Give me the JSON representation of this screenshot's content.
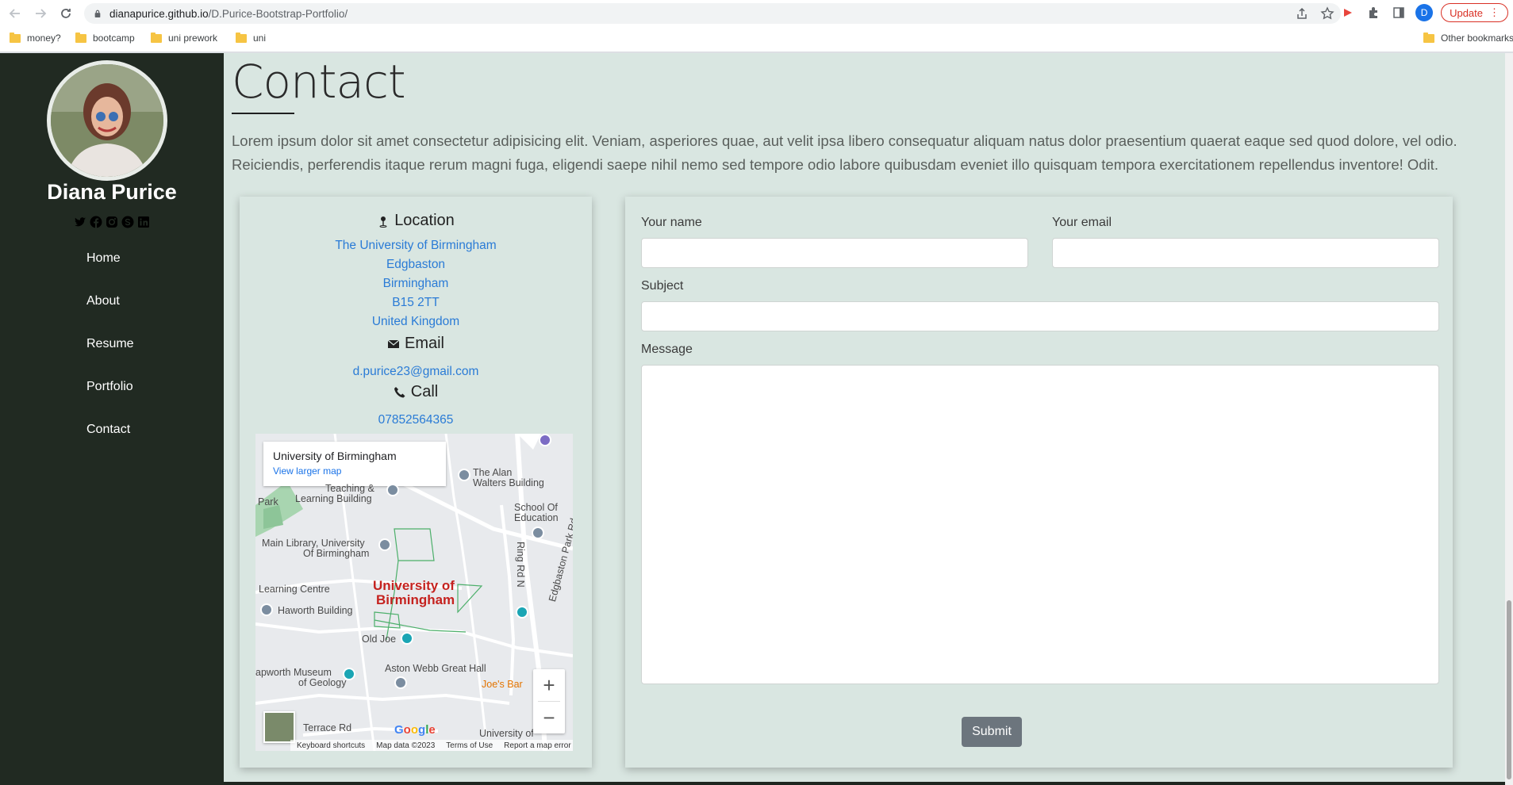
{
  "browser": {
    "url_host": "dianapurice.github.io",
    "url_path": "/D.Purice-Bootstrap-Portfolio/",
    "profile_initial": "D",
    "update_label": "Update",
    "bookmarks": [
      "money?",
      "bootcamp",
      "uni prework",
      "uni"
    ],
    "other_bookmarks": "Other bookmarks"
  },
  "sidebar": {
    "name": "Diana Purice",
    "socials": [
      "twitter-icon",
      "facebook-icon",
      "instagram-icon",
      "skype-icon",
      "linkedin-icon"
    ],
    "menu": [
      "Home",
      "About",
      "Resume",
      "Portfolio",
      "Contact"
    ]
  },
  "contact": {
    "title": "Contact",
    "intro": "Lorem ipsum dolor sit amet consectetur adipisicing elit. Veniam, asperiores quae, aut velit ipsa libero consequatur aliquam natus dolor praesentium quaerat eaque sed quod dolore, vel odio. Reiciendis, perferendis itaque rerum magni fuga, eligendi saepe nihil nemo sed tempore odio labore quibusdam eveniet illo quisquam tempora exercitationem repellendus inventore! Odit.",
    "location_heading": "Location",
    "address": [
      "The University of Birmingham",
      "Edgbaston",
      "Birmingham",
      "B15 2TT",
      "United Kingdom"
    ],
    "email_heading": "Email",
    "email": "d.purice23@gmail.com",
    "call_heading": "Call",
    "phone": "07852564365"
  },
  "map": {
    "place_title": "University of Birmingham",
    "larger_map": "View larger map",
    "center_label_1": "University of",
    "center_label_2": "Birmingham",
    "labels": {
      "alan_walters_1": "The Alan",
      "alan_walters_2": "Walters Building",
      "teaching_1": "Teaching &",
      "teaching_2": "Learning Building",
      "school_ed_1": "School Of",
      "school_ed_2": "Education",
      "park": "Park",
      "main_library_1": "Main Library, University",
      "main_library_2": "Of Birmingham",
      "learning_centre": "Learning Centre",
      "haworth": "Haworth Building",
      "old_joe": "Old Joe",
      "ring_rd": "Ring Rd N",
      "edgbaston_park": "Edgbaston Park Rd",
      "lapworth_1": "apworth Museum",
      "lapworth_2": "of Geology",
      "aston_webb": "Aston Webb Great Hall",
      "joes_bar": "Joe's Bar",
      "terrace": "Terrace Rd",
      "univ_bottom": "University of"
    },
    "google": "Google",
    "footer": [
      "Keyboard shortcuts",
      "Map data ©2023",
      "Terms of Use",
      "Report a map error"
    ]
  },
  "form": {
    "name_label": "Your name",
    "email_label": "Your email",
    "subject_label": "Subject",
    "message_label": "Message",
    "name_value": "",
    "email_value": "",
    "subject_value": "",
    "message_value": "",
    "submit_label": "Submit"
  },
  "colors": {
    "sidebar_bg": "#212a22",
    "page_bg": "#d9e6e1",
    "link": "#2a7bd6",
    "submit_bg": "#6c757d"
  }
}
